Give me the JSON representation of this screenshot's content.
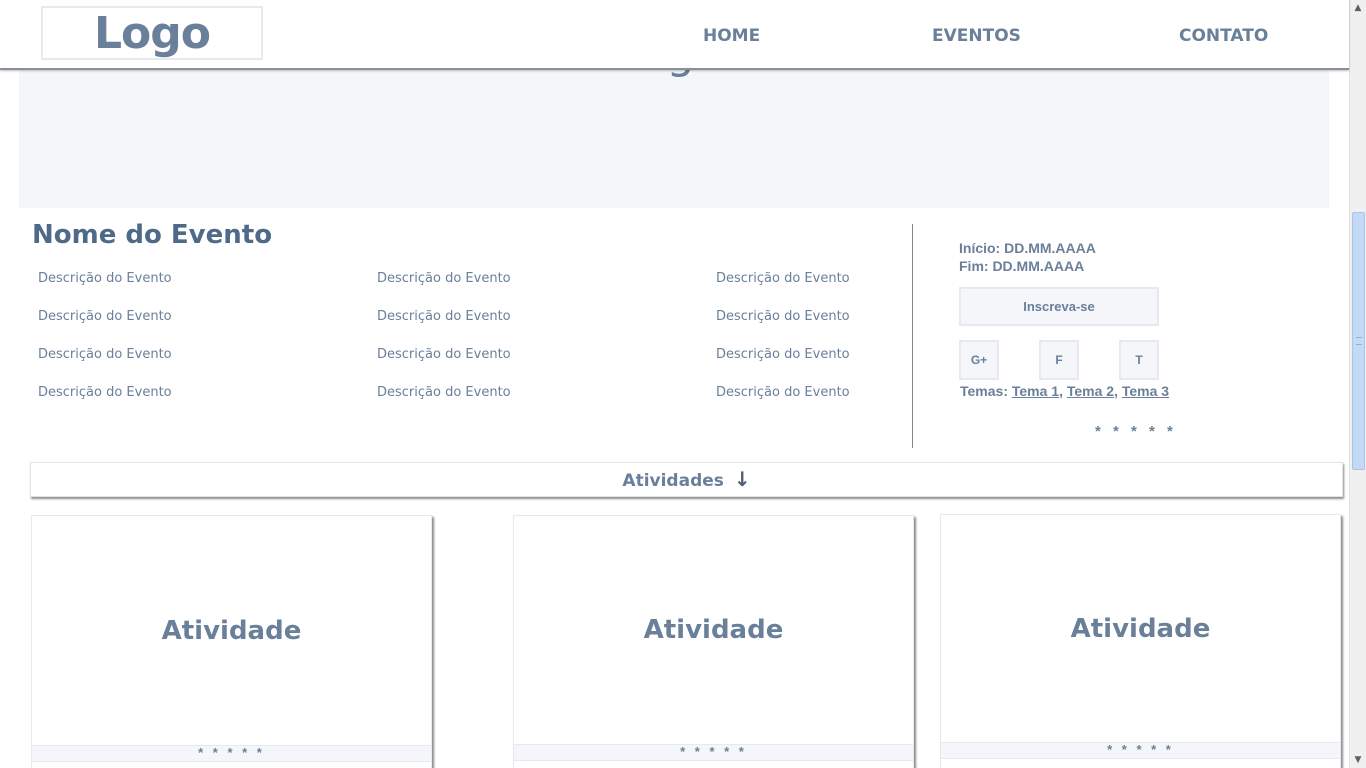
{
  "header": {
    "logo": "Logo",
    "nav": [
      {
        "label": "HOME"
      },
      {
        "label": "EVENTOS"
      },
      {
        "label": "CONTATO"
      }
    ]
  },
  "hero": {
    "text": "Imagem"
  },
  "event": {
    "title": "Nome do Evento",
    "description": "Descrição do Evento",
    "start": "Início: DD.MM.AAAA",
    "end": "Fim: DD.MM.AAAA",
    "subscribe": "Inscreva-se",
    "social": [
      "G+",
      "F",
      "T"
    ],
    "themes_label": "Temas:",
    "themes": [
      "Tema 1",
      "Tema 2",
      "Tema 3"
    ],
    "rating": "* * * * *"
  },
  "activities": {
    "label": "Atividades",
    "arrow": "↓",
    "cards": [
      {
        "title": "Atividade",
        "rating": "* * * * *"
      },
      {
        "title": "Atividade",
        "rating": "* * * * *"
      },
      {
        "title": "Atividade",
        "rating": "* * * * *"
      }
    ]
  },
  "scrollbar": {
    "up": "▲",
    "down": "▼",
    "thumb_position_fraction": 0.28
  }
}
